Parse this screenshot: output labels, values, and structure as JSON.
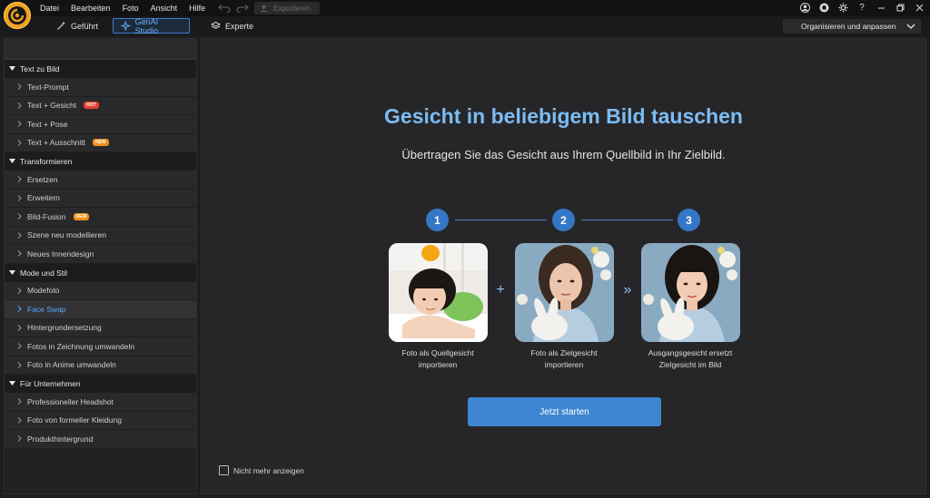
{
  "menu": [
    "Datei",
    "Bearbeiten",
    "Foto",
    "Ansicht",
    "Hilfe"
  ],
  "toolbar": {
    "export_label": "Exportieren"
  },
  "window_controls": {
    "help_label": "?"
  },
  "modes": [
    {
      "label": "Geführt",
      "icon": "magic-wand-icon"
    },
    {
      "label": "GenAI Studio",
      "icon": "sparkle-icon",
      "active": true
    },
    {
      "label": "Experte",
      "icon": "layers-icon"
    }
  ],
  "organize": {
    "label": "Organisieren und anpassen"
  },
  "sidebar": {
    "sections": [
      {
        "title": "Text zu Bild",
        "items": [
          {
            "label": "Text-Prompt"
          },
          {
            "label": "Text + Gesicht",
            "badge": "HOT"
          },
          {
            "label": "Text + Pose"
          },
          {
            "label": "Text + Ausschnitt",
            "badge": "NEW"
          }
        ]
      },
      {
        "title": "Transformieren",
        "items": [
          {
            "label": "Ersetzen"
          },
          {
            "label": "Erweitern"
          },
          {
            "label": "Bild-Fusion",
            "badge": "NEW"
          },
          {
            "label": "Szene neu modellieren"
          },
          {
            "label": "Neues Innendesign"
          }
        ]
      },
      {
        "title": "Mode und Stil",
        "items": [
          {
            "label": "Modefoto"
          },
          {
            "label": "Face Swap",
            "selected": true
          },
          {
            "label": "Hintergrundersetzung"
          },
          {
            "label": "Fotos in Zeichnung umwandeln"
          },
          {
            "label": "Foto in Anime umwandeln"
          }
        ]
      },
      {
        "title": "Für Unternehmen",
        "items": [
          {
            "label": "Professioneller Headshot"
          },
          {
            "label": "Foto von formeller Kleidung"
          },
          {
            "label": "Produkthintergrund"
          }
        ]
      }
    ]
  },
  "main": {
    "title": "Gesicht in beliebigem Bild tauschen",
    "subtitle": "Übertragen Sie das Gesicht aus Ihrem Quellbild in Ihr Zielbild.",
    "steps": [
      {
        "number": "1",
        "caption_line1": "Foto als Quellgesicht",
        "caption_line2": "importieren"
      },
      {
        "number": "2",
        "caption_line1": "Foto als Zielgesicht",
        "caption_line2": "importieren"
      },
      {
        "number": "3",
        "caption_line1": "Ausgangsgesicht ersetzt",
        "caption_line2": "Zielgesicht im Bild"
      }
    ],
    "connectors": {
      "plus": "+",
      "arrows": "»"
    },
    "start_button": "Jetzt starten",
    "dont_show_label": "Nicht mehr anzeigen"
  },
  "colors": {
    "accent": "#3e86d1",
    "title": "#7cbcf2",
    "hot_badge": "#e8402e",
    "new_badge": "#f0901c",
    "selected_text": "#5aa8f5"
  }
}
